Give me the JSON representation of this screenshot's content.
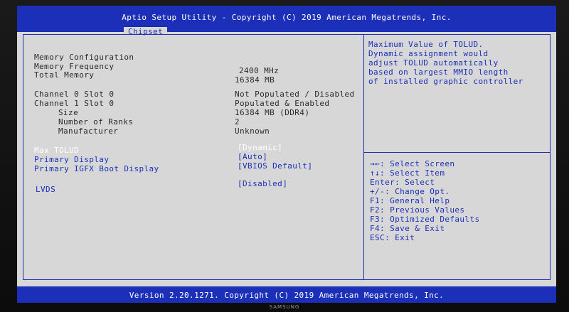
{
  "header": {
    "title": "Aptio Setup Utility - Copyright (C) 2019 American Megatrends, Inc.",
    "tab": "Chipset"
  },
  "settings": {
    "memory_configuration": "Memory Configuration",
    "memory_frequency": {
      "label": "Memory Frequency",
      "value": "2400 MHz"
    },
    "total_memory": {
      "label": "Total Memory",
      "value": "16384 MB"
    },
    "channel0_slot0": {
      "label": "Channel 0 Slot 0",
      "value": "Not Populated / Disabled"
    },
    "channel1_slot0": {
      "label": "Channel 1 Slot 0",
      "value": "Populated & Enabled"
    },
    "size": {
      "label": "Size",
      "value": "16384 MB (DDR4)"
    },
    "ranks": {
      "label": "Number of Ranks",
      "value": "2"
    },
    "manufacturer": {
      "label": "Manufacturer",
      "value": "Unknown"
    },
    "max_tolud": {
      "label": "Max TOLUD",
      "value": "[Dynamic]"
    },
    "primary_display": {
      "label": "Primary Display",
      "value": "[Auto]"
    },
    "primary_igfx": {
      "label": "Primary IGFX Boot Display",
      "value": "[VBIOS Default]"
    },
    "lvds": {
      "label": "LVDS",
      "value": "[Disabled]"
    }
  },
  "help": {
    "lines": [
      "Maximum Value of TOLUD.",
      "Dynamic assignment would",
      "adjust TOLUD automatically",
      "based on largest MMIO length",
      "of installed graphic controller"
    ]
  },
  "keys": [
    "→←: Select Screen",
    "↑↓: Select Item",
    "Enter: Select",
    "+/-: Change Opt.",
    "F1: General Help",
    "F2: Previous Values",
    "F3: Optimized Defaults",
    "F4: Save & Exit",
    "ESC: Exit"
  ],
  "footer": "Version 2.20.1271. Copyright (C) 2019 American Megatrends, Inc.",
  "brand": "SAMSUNG",
  "colors": {
    "accent": "#1c2fb8",
    "background": "#d7d7d7",
    "text": "#2a2a2a",
    "selected": "#ffffff"
  }
}
